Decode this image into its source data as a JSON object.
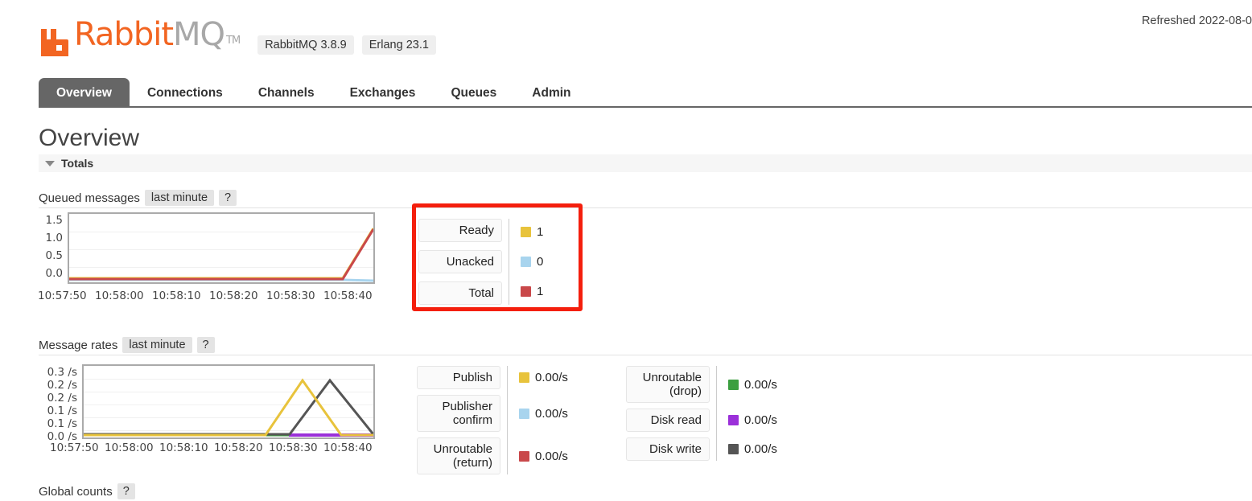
{
  "header": {
    "refreshed": "Refreshed 2022-08-0",
    "logo_rabbit": "Rabbit",
    "logo_mq": "MQ",
    "logo_tm": "TM",
    "version_badges": [
      {
        "label": "RabbitMQ 3.8.9"
      },
      {
        "label": "Erlang 23.1"
      }
    ]
  },
  "tabs": [
    {
      "label": "Overview",
      "active": true
    },
    {
      "label": "Connections",
      "active": false
    },
    {
      "label": "Channels",
      "active": false
    },
    {
      "label": "Exchanges",
      "active": false
    },
    {
      "label": "Queues",
      "active": false
    },
    {
      "label": "Admin",
      "active": false
    }
  ],
  "page": {
    "title": "Overview",
    "section_totals": "Totals",
    "queued_messages_label": "Queued messages",
    "queued_messages_period": "last minute",
    "help_badge": "?",
    "message_rates_label": "Message rates",
    "message_rates_period": "last minute",
    "global_counts_label": "Global counts"
  },
  "queued_legend": [
    {
      "name": "Ready",
      "value": "1",
      "color": "#e8c33c"
    },
    {
      "name": "Unacked",
      "value": "0",
      "color": "#a8d4ee"
    },
    {
      "name": "Total",
      "value": "1",
      "color": "#c9484a"
    }
  ],
  "rates_legend_left": [
    {
      "name": "Publish",
      "value": "0.00/s",
      "color": "#e8c33c"
    },
    {
      "name": "Publisher\nconfirm",
      "value": "0.00/s",
      "color": "#a8d4ee"
    },
    {
      "name": "Unroutable\n(return)",
      "value": "0.00/s",
      "color": "#c9484a"
    }
  ],
  "rates_legend_right": [
    {
      "name": "Unroutable\n(drop)",
      "value": "0.00/s",
      "color": "#3c9f40"
    },
    {
      "name": "Disk read",
      "value": "0.00/s",
      "color": "#9b30d9"
    },
    {
      "name": "Disk write",
      "value": "0.00/s",
      "color": "#555555"
    }
  ],
  "annotation": {
    "color": "#f41f0d"
  },
  "chart_data": [
    {
      "type": "line",
      "title": "Queued messages",
      "xlabel": "",
      "ylabel": "",
      "ylim": [
        0,
        1.5
      ],
      "yticks": [
        "0.0",
        "0.5",
        "1.0",
        "1.5"
      ],
      "xticks": [
        "10:57:50",
        "10:58:00",
        "10:58:10",
        "10:58:20",
        "10:58:30",
        "10:58:40"
      ],
      "grid": true,
      "legend_position": "right",
      "series": [
        {
          "name": "Ready",
          "color": "#e8c33c",
          "x": [
            0,
            50,
            55,
            60
          ],
          "values": [
            0,
            0,
            0,
            1
          ]
        },
        {
          "name": "Unacked",
          "color": "#a8d4ee",
          "x": [
            0,
            50,
            55,
            60
          ],
          "values": [
            0,
            0,
            0,
            0
          ]
        },
        {
          "name": "Total",
          "color": "#c9484a",
          "x": [
            0,
            50,
            55,
            60
          ],
          "values": [
            0,
            0,
            0,
            1
          ]
        }
      ]
    },
    {
      "type": "line",
      "title": "Message rates",
      "xlabel": "",
      "ylabel": "",
      "ylim": [
        0,
        0.3
      ],
      "yticks": [
        "0.0 /s",
        "0.1 /s",
        "0.1 /s",
        "0.2 /s",
        "0.2 /s",
        "0.3 /s"
      ],
      "xticks": [
        "10:57:50",
        "10:58:00",
        "10:58:10",
        "10:58:20",
        "10:58:30",
        "10:58:40"
      ],
      "grid": true,
      "legend_position": "right",
      "series": [
        {
          "name": "Publish",
          "color": "#e8c33c",
          "x": [
            0,
            45,
            50,
            55
          ],
          "values": [
            0,
            0,
            0.2,
            0
          ]
        },
        {
          "name": "Publisher confirm",
          "color": "#a8d4ee",
          "x": [
            0,
            60
          ],
          "values": [
            0,
            0
          ]
        },
        {
          "name": "Unroutable (return)",
          "color": "#c9484a",
          "x": [
            0,
            60
          ],
          "values": [
            0,
            0
          ]
        },
        {
          "name": "Unroutable (drop)",
          "color": "#3c9f40",
          "x": [
            0,
            60
          ],
          "values": [
            0,
            0
          ]
        },
        {
          "name": "Disk read",
          "color": "#9b30d9",
          "x": [
            48,
            60
          ],
          "values": [
            0,
            0
          ]
        },
        {
          "name": "Disk write",
          "color": "#555555",
          "x": [
            0,
            48,
            54,
            60
          ],
          "values": [
            0,
            0,
            0.2,
            0
          ]
        }
      ]
    }
  ]
}
